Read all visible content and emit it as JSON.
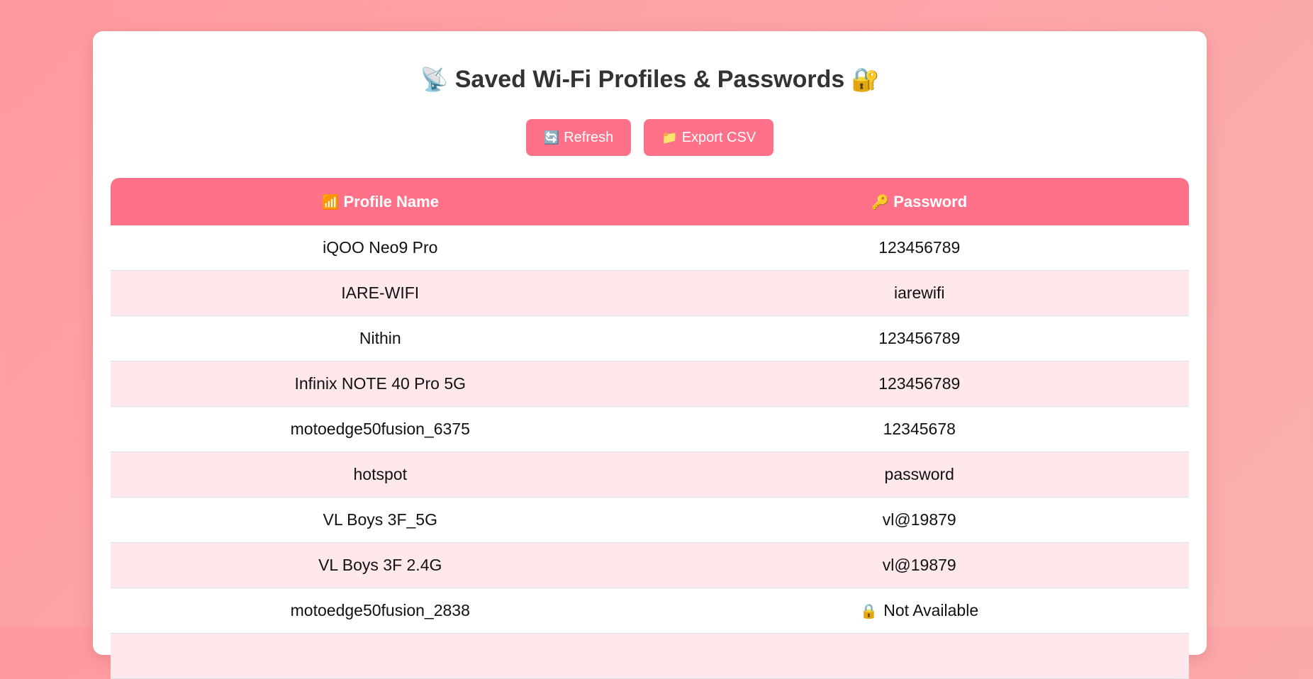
{
  "header": {
    "title": "Saved Wi-Fi Profiles & Passwords",
    "title_emoji_left": "📡",
    "title_emoji_right": "🔐"
  },
  "toolbar": {
    "refresh_icon": "🔄",
    "refresh_label": "Refresh",
    "export_icon": "📁",
    "export_label": "Export CSV"
  },
  "table": {
    "columns": {
      "profile_icon": "📶",
      "profile_label": "Profile Name",
      "password_icon": "🔑",
      "password_label": "Password"
    },
    "rows": [
      {
        "profile": "iQOO Neo9 Pro",
        "password": "123456789"
      },
      {
        "profile": "IARE-WIFI",
        "password": "iarewifi"
      },
      {
        "profile": "Nithin",
        "password": "123456789"
      },
      {
        "profile": "Infinix NOTE 40 Pro 5G",
        "password": "123456789"
      },
      {
        "profile": "motoedge50fusion_6375",
        "password": "12345678"
      },
      {
        "profile": "hotspot",
        "password": "password"
      },
      {
        "profile": "VL Boys 3F_5G",
        "password": "vl@19879"
      },
      {
        "profile": "VL Boys 3F 2.4G",
        "password": "vl@19879"
      },
      {
        "profile": "motoedge50fusion_2838",
        "password": "Not Available",
        "password_icon": "🔒"
      }
    ]
  },
  "colors": {
    "accent": "#ff7189",
    "row_alt": "#ffe8ec",
    "background": "#ff9a9e"
  }
}
